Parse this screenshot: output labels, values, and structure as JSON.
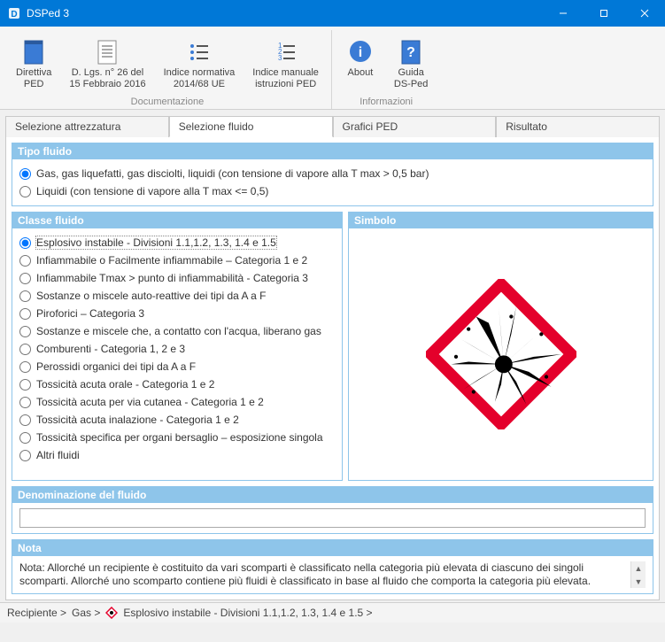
{
  "window": {
    "title": "DSPed 3"
  },
  "ribbon": {
    "groups": [
      {
        "label": "Documentazione",
        "items": [
          {
            "id": "direttiva-ped",
            "label": "Direttiva\nPED"
          },
          {
            "id": "dlgs-26",
            "label": "D. Lgs. n° 26 del\n15 Febbraio 2016"
          },
          {
            "id": "indice-normativa",
            "label": "Indice normativa\n2014/68 UE"
          },
          {
            "id": "indice-manuale",
            "label": "Indice manuale\nistruzioni PED"
          }
        ]
      },
      {
        "label": "Informazioni",
        "items": [
          {
            "id": "about",
            "label": "About"
          },
          {
            "id": "guida",
            "label": "Guida\nDS-Ped"
          }
        ]
      }
    ]
  },
  "tabs": {
    "items": [
      {
        "id": "attrezzatura",
        "label": "Selezione attrezzatura"
      },
      {
        "id": "fluido",
        "label": "Selezione fluido"
      },
      {
        "id": "grafici",
        "label": "Grafici PED"
      },
      {
        "id": "risultato",
        "label": "Risultato"
      }
    ],
    "active": "fluido"
  },
  "tipo_fluido": {
    "title": "Tipo fluido",
    "options": [
      "Gas, gas liquefatti, gas disciolti, liquidi (con tensione di vapore alla T max > 0,5 bar)",
      "Liquidi (con tensione di vapore alla T max <= 0,5)"
    ],
    "selected": 0
  },
  "classe_fluido": {
    "title": "Classe fluido",
    "options": [
      "Esplosivo instabile - Divisioni 1.1,1.2, 1.3, 1.4 e 1.5",
      "Infiammabile o Facilmente infiammabile – Categoria 1 e 2",
      "Infiammabile Tmax > punto di infiammabilità - Categoria 3",
      "Sostanze o miscele auto-reattive dei tipi da A a F",
      "Piroforici – Categoria 3",
      "Sostanze e miscele che, a contatto con l'acqua, liberano gas",
      "Comburenti - Categoria 1, 2 e 3",
      "Perossidi organici dei tipi da A a F",
      "Tossicità acuta orale - Categoria 1 e 2",
      "Tossicità acuta per via cutanea - Categoria 1 e 2",
      "Tossicità acuta inalazione - Categoria 1 e 2",
      "Tossicità specifica per organi bersaglio – esposizione singola",
      "Altri fluidi"
    ],
    "selected": 0
  },
  "simbolo": {
    "title": "Simbolo"
  },
  "denominazione": {
    "title": "Denominazione del fluido",
    "value": ""
  },
  "nota": {
    "title": "Nota",
    "text": "Nota: Allorché un recipiente è costituito da vari scomparti è classificato nella categoria più elevata di ciascuno dei singoli scomparti. Allorché uno scomparto contiene più fluidi è classificato in base al fluido che comporta la categoria più elevata."
  },
  "status": {
    "parts": [
      "Recipiente  >",
      "Gas  >",
      "Esplosivo instabile - Divisioni 1.1,1.2, 1.3, 1.4 e 1.5 >"
    ]
  }
}
